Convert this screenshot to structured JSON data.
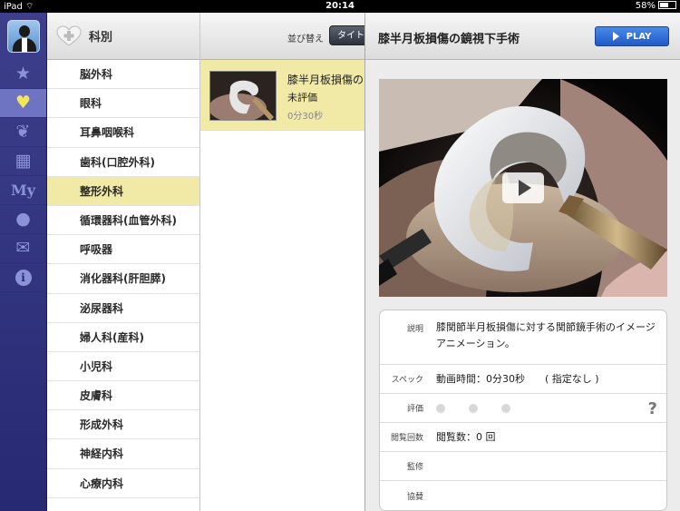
{
  "status_bar": {
    "device": "iPad",
    "time": "20:14",
    "battery": "58%",
    "battery_level": 0.58
  },
  "icon_bar": {
    "items": [
      {
        "icon": "star-icon",
        "active": false
      },
      {
        "icon": "heart-plus-icon",
        "active": true
      },
      {
        "icon": "organ-icon",
        "active": false
      },
      {
        "icon": "clapperboard-icon",
        "active": false
      },
      {
        "icon": "my-icon",
        "label": "My",
        "active": false
      },
      {
        "icon": "person-icon",
        "active": false
      },
      {
        "icon": "mail-icon",
        "active": false
      },
      {
        "icon": "info-icon",
        "label": "i",
        "active": false
      }
    ]
  },
  "departments": {
    "title": "科別",
    "items": [
      {
        "label": "脳外科",
        "selected": false
      },
      {
        "label": "眼科",
        "selected": false
      },
      {
        "label": "耳鼻咽喉科",
        "selected": false
      },
      {
        "label": "歯科(口腔外科)",
        "selected": false
      },
      {
        "label": "整形外科",
        "selected": true
      },
      {
        "label": "循環器科(血管外科)",
        "selected": false
      },
      {
        "label": "呼吸器",
        "selected": false
      },
      {
        "label": "消化器科(肝胆膵)",
        "selected": false
      },
      {
        "label": "泌尿器科",
        "selected": false
      },
      {
        "label": "婦人科(産科)",
        "selected": false
      },
      {
        "label": "小児科",
        "selected": false
      },
      {
        "label": "皮膚科",
        "selected": false
      },
      {
        "label": "形成外科",
        "selected": false
      },
      {
        "label": "神経内科",
        "selected": false
      },
      {
        "label": "心療内科",
        "selected": false
      }
    ]
  },
  "video_list": {
    "sort_label": "並び替え",
    "sort_button": "タイトル",
    "items": [
      {
        "title": "膝半月板損傷の",
        "rating": "未評価",
        "duration": "0分30秒"
      }
    ]
  },
  "detail": {
    "title": "膝半月板損傷の鏡視下手術",
    "play_label": "PLAY",
    "rows": {
      "description": {
        "label": "説明",
        "value": "膝関節半月板損傷に対する関節鏡手術のイメージアニメーション。"
      },
      "spec": {
        "label": "スペック",
        "value": "動画時間：0分30秒　　( 指定なし )"
      },
      "rating": {
        "label": "評価",
        "help": "?"
      },
      "views": {
        "label": "閲覧回数",
        "value": "閲覧数：0 回"
      },
      "supervision": {
        "label": "監修",
        "value": ""
      },
      "sponsor": {
        "label": "協賛",
        "value": ""
      }
    }
  },
  "colors": {
    "accent_selected": "#f1e9a6",
    "sidebar": "#2f3380",
    "play": "#2b66d4"
  }
}
